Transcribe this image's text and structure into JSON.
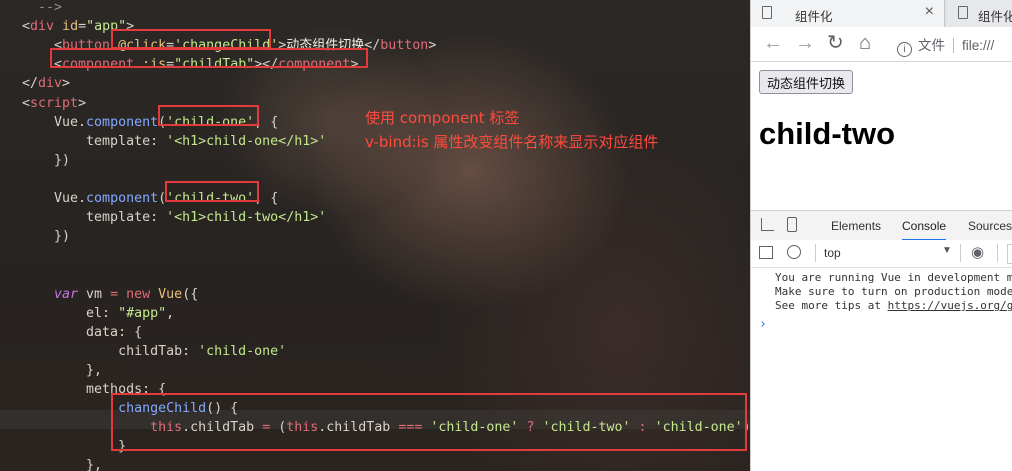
{
  "editor": {
    "lines": [
      [
        {
          "c": "p",
          "v": "  "
        },
        {
          "c": "gr",
          "v": "-->"
        }
      ],
      [
        {
          "c": "p",
          "v": "<"
        },
        {
          "c": "t",
          "v": "div"
        },
        {
          "c": "p",
          "v": " "
        },
        {
          "c": "a",
          "v": "id"
        },
        {
          "c": "p",
          "v": "="
        },
        {
          "c": "s",
          "v": "\"app\""
        },
        {
          "c": "p",
          "v": ">"
        }
      ],
      [
        {
          "c": "p",
          "v": "    <"
        },
        {
          "c": "t",
          "v": "button"
        },
        {
          "c": "p",
          "v": " "
        },
        {
          "c": "a",
          "v": "@click"
        },
        {
          "c": "p",
          "v": "="
        },
        {
          "c": "s",
          "v": "'changeChild'"
        },
        {
          "c": "p",
          "v": ">"
        },
        {
          "c": "cjk",
          "v": "动态组件切换"
        },
        {
          "c": "p",
          "v": "</"
        },
        {
          "c": "t",
          "v": "button"
        },
        {
          "c": "p",
          "v": ">"
        }
      ],
      [
        {
          "c": "p",
          "v": "    <"
        },
        {
          "c": "t",
          "v": "component"
        },
        {
          "c": "p",
          "v": " "
        },
        {
          "c": "a",
          "v": ":is"
        },
        {
          "c": "p",
          "v": "="
        },
        {
          "c": "s",
          "v": "\"childTab\""
        },
        {
          "c": "p",
          "v": "></"
        },
        {
          "c": "t",
          "v": "component"
        },
        {
          "c": "p",
          "v": ">"
        }
      ],
      [
        {
          "c": "p",
          "v": "</"
        },
        {
          "c": "t",
          "v": "div"
        },
        {
          "c": "p",
          "v": ">"
        }
      ],
      [
        {
          "c": "p",
          "v": "<"
        },
        {
          "c": "t",
          "v": "script"
        },
        {
          "c": "p",
          "v": ">"
        }
      ],
      [
        {
          "c": "p",
          "v": "    Vue."
        },
        {
          "c": "fn",
          "v": "component"
        },
        {
          "c": "p",
          "v": "("
        },
        {
          "c": "s",
          "v": "'child-one'"
        },
        {
          "c": "p",
          "v": ", {"
        }
      ],
      [
        {
          "c": "p",
          "v": "        template: "
        },
        {
          "c": "s",
          "v": "'<h1>child-one</h1>'"
        }
      ],
      [
        {
          "c": "p",
          "v": "    })"
        }
      ],
      [],
      [
        {
          "c": "p",
          "v": "    Vue."
        },
        {
          "c": "fn",
          "v": "component"
        },
        {
          "c": "p",
          "v": "("
        },
        {
          "c": "s",
          "v": "'child-two'"
        },
        {
          "c": "p",
          "v": ", {"
        }
      ],
      [
        {
          "c": "p",
          "v": "        template: "
        },
        {
          "c": "s",
          "v": "'<h1>child-two</h1>'"
        }
      ],
      [
        {
          "c": "p",
          "v": "    })"
        }
      ],
      [],
      [],
      [
        {
          "c": "kw",
          "v": "    var"
        },
        {
          "c": "p",
          "v": " vm "
        },
        {
          "c": "op",
          "v": "="
        },
        {
          "c": "p",
          "v": " "
        },
        {
          "c": "nw",
          "v": "new"
        },
        {
          "c": "p",
          "v": " "
        },
        {
          "c": "yl",
          "v": "Vue"
        },
        {
          "c": "p",
          "v": "({"
        }
      ],
      [
        {
          "c": "p",
          "v": "        el: "
        },
        {
          "c": "s",
          "v": "\"#app\""
        },
        {
          "c": "p",
          "v": ","
        }
      ],
      [
        {
          "c": "p",
          "v": "        data: {"
        }
      ],
      [
        {
          "c": "p",
          "v": "            childTab: "
        },
        {
          "c": "s",
          "v": "'child-one'"
        }
      ],
      [
        {
          "c": "p",
          "v": "        },"
        }
      ],
      [
        {
          "c": "p",
          "v": "        methods: {"
        }
      ],
      [
        {
          "c": "p",
          "v": "            "
        },
        {
          "c": "fn",
          "v": "changeChild"
        },
        {
          "c": "p",
          "v": "() {"
        }
      ],
      [
        {
          "c": "p",
          "v": "                "
        },
        {
          "c": "th",
          "v": "this"
        },
        {
          "c": "p",
          "v": ".childTab "
        },
        {
          "c": "op",
          "v": "="
        },
        {
          "c": "p",
          "v": " ("
        },
        {
          "c": "th",
          "v": "this"
        },
        {
          "c": "p",
          "v": ".childTab "
        },
        {
          "c": "op",
          "v": "==="
        },
        {
          "c": "p",
          "v": " "
        },
        {
          "c": "s",
          "v": "'child-one'"
        },
        {
          "c": "p",
          "v": " "
        },
        {
          "c": "op",
          "v": "?"
        },
        {
          "c": "p",
          "v": " "
        },
        {
          "c": "s",
          "v": "'child-two'"
        },
        {
          "c": "p",
          "v": " "
        },
        {
          "c": "op",
          "v": ":"
        },
        {
          "c": "p",
          "v": " "
        },
        {
          "c": "s",
          "v": "'child-one'"
        },
        {
          "c": "p",
          "v": ");"
        }
      ],
      [
        {
          "c": "p",
          "v": "            }"
        }
      ],
      [
        {
          "c": "p",
          "v": "        },"
        }
      ]
    ],
    "annotation_line1": "使用 component 标签",
    "annotation_line2": "v-bind:is 属性改变组件名称来显示对应组件",
    "highlight_color": "#e33b3b"
  },
  "browser": {
    "tab1_title": "组件化",
    "tab2_title": "组件化",
    "close_glyph": "×",
    "address_prefix": "文件",
    "address": "file:///",
    "page_button_label": "动态组件切换",
    "page_heading": "child-two",
    "devtools_tabs": [
      "Elements",
      "Console",
      "Sources"
    ],
    "active_devtools_tab": "Console",
    "context_select": "top",
    "console_lines": [
      "You are running Vue in development m",
      "Make sure to turn on production mode",
      "See more tips at "
    ],
    "console_link": "https://vuejs.org/gu",
    "prompt_glyph": "›"
  }
}
